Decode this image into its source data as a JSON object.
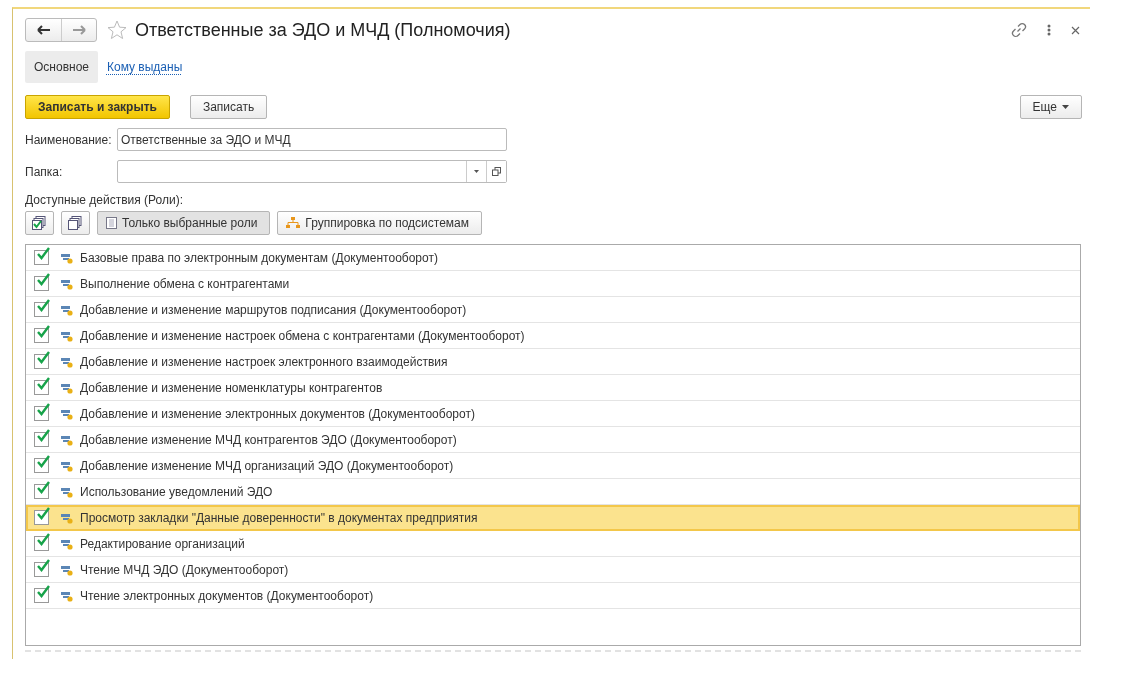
{
  "window": {
    "title": "Ответственные за ЭДО и МЧД (Полномочия)",
    "favorite": false
  },
  "tabs": [
    {
      "label": "Основное",
      "selected": true
    },
    {
      "label": "Кому выданы",
      "selected": false
    }
  ],
  "command_bar": {
    "primary": "Записать и закрыть",
    "secondary": "Записать",
    "more": "Еще"
  },
  "fields": [
    {
      "label": "Наименование:",
      "value": "Ответственные за ЭДО и МЧД",
      "kind": "text"
    },
    {
      "label": "Папка:",
      "kind": "select"
    }
  ],
  "roles": {
    "label": "Доступные действия (Роли):",
    "toolbar": [
      {
        "kind": "check-all"
      },
      {
        "kind": "copy"
      },
      {
        "kind": "toggle",
        "label": "Только выбранные роли",
        "pressed": true
      },
      {
        "kind": "grouping",
        "label": "Группировка по подсистемам",
        "pressed": false
      }
    ],
    "rows": [
      {
        "name": "Базовые права по электронным документам (Документооборот)",
        "checked": true,
        "selected": false
      },
      {
        "name": "Выполнение обмена с контрагентами",
        "checked": true,
        "selected": false
      },
      {
        "name": "Добавление и изменение маршрутов подписания (Документооборот)",
        "checked": true,
        "selected": false
      },
      {
        "name": "Добавление и изменение настроек обмена с контрагентами (Документооборот)",
        "checked": true,
        "selected": false
      },
      {
        "name": "Добавление и изменение настроек электронного взаимодействия",
        "checked": true,
        "selected": false
      },
      {
        "name": "Добавление и изменение номенклатуры контрагентов",
        "checked": true,
        "selected": false
      },
      {
        "name": "Добавление и изменение электронных документов (Документооборот)",
        "checked": true,
        "selected": false
      },
      {
        "name": "Добавление изменение МЧД контрагентов ЭДО (Документооборот)",
        "checked": true,
        "selected": false
      },
      {
        "name": "Добавление изменение МЧД организаций ЭДО (Документооборот)",
        "checked": true,
        "selected": false
      },
      {
        "name": "Использование уведомлений ЭДО",
        "checked": true,
        "selected": false
      },
      {
        "name": "Просмотр закладки \"Данные доверенности\" в документах предприятия",
        "checked": true,
        "selected": true
      },
      {
        "name": "Редактирование организаций",
        "checked": true,
        "selected": false
      },
      {
        "name": "Чтение МЧД ЭДО (Документооборот)",
        "checked": true,
        "selected": false
      },
      {
        "name": "Чтение электронных документов (Документооборот)",
        "checked": true,
        "selected": false
      }
    ]
  }
}
